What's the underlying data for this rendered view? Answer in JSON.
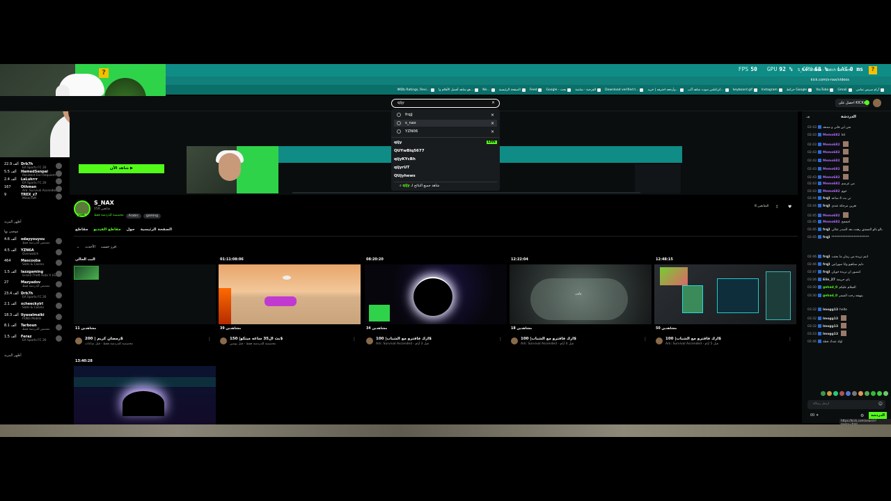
{
  "overlay": {
    "fps_label": "FPS",
    "fps": "50",
    "gpu_label": "GPU",
    "gpu": "92 %",
    "cpu_label": "CPU",
    "cpu": "68 %",
    "lat_label": "LAT",
    "lat": "0 ms"
  },
  "browser": {
    "tab_title": "S_NAX Videos - Watch On-Dem",
    "address": "kick.com/s-nax/videos",
    "bookmarks": [
      "آرام سرس تمامی",
      "Gmail",
      "YouTube",
      "خرائط Google",
      "Instagram",
      "keyboard gif",
      "اتزاعلس سوت شاهد آلب...",
      "وأرجعه احترفه | خريد...",
      "Download verified t...",
      "القرحبة - شاشة",
      "Google - بحث",
      "Feed",
      "الصفحة الرئيسية",
      "Ne...",
      "هو شاهد أفضل الأفلام وا...",
      "IMDb Ratings, Revi..."
    ]
  },
  "header": {
    "search_value": "qijy",
    "kicks_label": "احصل على KICKs"
  },
  "search_dropdown": {
    "recent": [
      "frqjj",
      "s_nax",
      "YZN06"
    ],
    "suggestions": [
      "qijy",
      "QUYwBiq5677",
      "qijyKYcBh",
      "qijyrUT",
      "QUjyhews"
    ],
    "live_badge": "LIVE",
    "see_all_prefix": "شاهد جميع النتائج لـ",
    "see_all_query": "qijy"
  },
  "left_sidebar": {
    "top_channels": [
      {
        "viewers": "22.9 ألف",
        "name": "Drb7h",
        "game": "EA Sports FC 26"
      },
      {
        "viewers": "5.5 ألف",
        "name": "HamedSenpai",
        "game": "Resident Evil Requiem"
      },
      {
        "viewers": "2.4 ألف",
        "name": "LaLukrrr",
        "game": "EA Sports FC 26"
      },
      {
        "viewers": "167",
        "name": "Othman",
        "game": "Ark: Survival Ascended"
      },
      {
        "viewers": "9",
        "name": "TREX_z7",
        "game": "Minecraft"
      }
    ],
    "show_more_1": "أظهر المزيد",
    "recommended_heading": "موصى بها",
    "recommended": [
      {
        "viewers": "4.6 ألف",
        "name": "odayyouyou",
        "game": "مقصص للدردشة فقط"
      },
      {
        "viewers": "4.5 ألف",
        "name": "YZN6A",
        "game": "Overwatch"
      },
      {
        "viewers": "464",
        "name": "Mascooba",
        "game": "Slots & Casino"
      },
      {
        "viewers": "1.5 ألف",
        "name": "Iazzgaming",
        "game": "Grand Theft Auto V (GTA)"
      },
      {
        "viewers": "27",
        "name": "Mazyadov",
        "game": "مقصص للدردشة فقط"
      },
      {
        "viewers": "23.4 ألف",
        "name": "Drb7h",
        "game": "EA Sports FC 26"
      },
      {
        "viewers": "2.1 ألف",
        "name": "xcheeckyirl",
        "game": "Slots & Casino"
      },
      {
        "viewers": "18.3 ألف",
        "name": "Ilyasalmalki",
        "game": "PUBG Mobile"
      },
      {
        "viewers": "8.1 ألف",
        "name": "Tarboun",
        "game": "مقصص للدردشة فقط"
      },
      {
        "viewers": "1.5 ألف",
        "name": "Feraz",
        "game": "EA Sports FC 26"
      }
    ],
    "show_more_2": "أظهر المزيد"
  },
  "stream": {
    "watch_now": "شاهد الآن ▶"
  },
  "channel": {
    "name": "S_NAX",
    "followers": "150 متابعين",
    "category": "مخصصة للدردشة فقط",
    "tags": [
      "Arabic",
      "gaming"
    ],
    "live": "LIVE",
    "follow_text": "المتابعين 8",
    "tabs": [
      "مقاطع",
      "مقاطع الفيديو",
      "حول",
      "الصفحة الرئيسية"
    ],
    "sort_label": "فرز حسب:",
    "sort_value": "الأحدث"
  },
  "videos": [
    {
      "duration": "البث الحالي",
      "views": "11 مشاهدين",
      "title": "رمضان كريم | 200$",
      "category": "مخصصة للدردشة فقط - قبل ساعات"
    },
    {
      "duration": "01:11:08:06",
      "views": "39 مشاهدين",
      "title": "بث ال35 ساعه ميتكو| 150$",
      "category": "مخصصة للدردشة فقط - قبل يومين"
    },
    {
      "duration": "08:20:20",
      "views": "34 مشاهدين",
      "title": "ارك فاقترو مع الشباب| 100$",
      "category": "Ark: Survival Ascended - قبل 3 أيام"
    },
    {
      "duration": "12:22:04",
      "views": "18 مشاهدين",
      "title": "ارك فاقترو مع الشباب| 100$",
      "category": "Ark: Survival Ascended - قبل 4 أيام"
    },
    {
      "duration": "12:48:15",
      "views": "50 مشاهدين",
      "title": "ارك فاقترو مع الشباب| 100$",
      "category": "Ark: Survival Ascended - قبل 5 أيام"
    },
    {
      "duration": "13:40:28",
      "views": "",
      "title": "",
      "category": ""
    }
  ],
  "thumb_text": "ولهي",
  "chat": {
    "title": "الدردشة",
    "messages": [
      {
        "time": "02:43",
        "user": "",
        "color": "#ddd",
        "text": "متن اين قاني و مندهد"
      },
      {
        "time": "02:43",
        "user": "Memo682",
        "color": "#b26bff",
        "text": "lol"
      },
      {
        "time": "02:43",
        "user": "Memo682",
        "color": "#b26bff",
        "text": ""
      },
      {
        "time": "02:43",
        "user": "Memo682",
        "color": "#b26bff",
        "text": ""
      },
      {
        "time": "02:43",
        "user": "Memo682",
        "color": "#b26bff",
        "text": ""
      },
      {
        "time": "02:43",
        "user": "Memo682",
        "color": "#b26bff",
        "text": ""
      },
      {
        "time": "02:43",
        "user": "Memo682",
        "color": "#b26bff",
        "text": ""
      },
      {
        "time": "02:43",
        "user": "Memo682",
        "color": "#b26bff",
        "text": "من عرسم"
      },
      {
        "time": "02:43",
        "user": "Memo682",
        "color": "#b26bff",
        "text": "خوم"
      },
      {
        "time": "02:44",
        "user": "frqjl",
        "color": "#ddd",
        "text": "تي بث 4 ساعه"
      },
      {
        "time": "02:44",
        "user": "frqjl",
        "color": "#ddd",
        "text": "تعرين مرجكة عندي"
      },
      {
        "time": "02:45",
        "user": "Memo682",
        "color": "#b26bff",
        "text": ""
      },
      {
        "time": "02:45",
        "user": "Memo682",
        "color": "#b26bff",
        "text": "احححح"
      },
      {
        "time": "02:45",
        "user": "frqjl",
        "color": "#ddd",
        "text": "بالو بالو المستق رهنت بعد الصدر عنالي"
      },
      {
        "time": "02:45",
        "user": "frqjl",
        "color": "#ddd",
        "text": "************************"
      },
      {
        "time": "02:46",
        "user": "frqjl",
        "color": "#ddd",
        "text": "انتم تريدة من زمان ما بحتت"
      },
      {
        "time": "02:46",
        "user": "frqjl",
        "color": "#ddd",
        "text": "دايم ستاهيو وانا سهرانين"
      },
      {
        "time": "02:47",
        "user": "frqjl",
        "color": "#ddd",
        "text": "انتصور ان تريدة خوبان"
      },
      {
        "time": "03:26",
        "user": "Eiln_27",
        "color": "#ddd",
        "text": "ياي حريمة"
      },
      {
        "time": "03:30",
        "user": "gehad_0",
        "color": "#53fc18",
        "text": "السلام عليكم"
      },
      {
        "time": "03:30",
        "user": "gehad_0",
        "color": "#53fc18",
        "text": "بنهيفه رحت السمر"
      },
      {
        "time": "03:32",
        "user": "lmogg13",
        "color": "#ddd",
        "text": "hello"
      },
      {
        "time": "03:32",
        "user": "lmogg13",
        "color": "#ddd",
        "text": ""
      },
      {
        "time": "03:32",
        "user": "lmogg13",
        "color": "#ddd",
        "text": ""
      },
      {
        "time": "03:33",
        "user": "lmogg13",
        "color": "#ddd",
        "text": ""
      },
      {
        "time": "02:46",
        "user": "",
        "color": "#e91916",
        "text": "اولة عندك قطة"
      }
    ],
    "input_placeholder": "ارسل رسالة",
    "send_label": "الدردشة",
    "points": "00",
    "status_url": "https://kick.com/search?query=frqjl"
  },
  "colors": {
    "accent": "#53fc18",
    "teal": "#0f8c86",
    "bg": "#0b0e0f"
  }
}
